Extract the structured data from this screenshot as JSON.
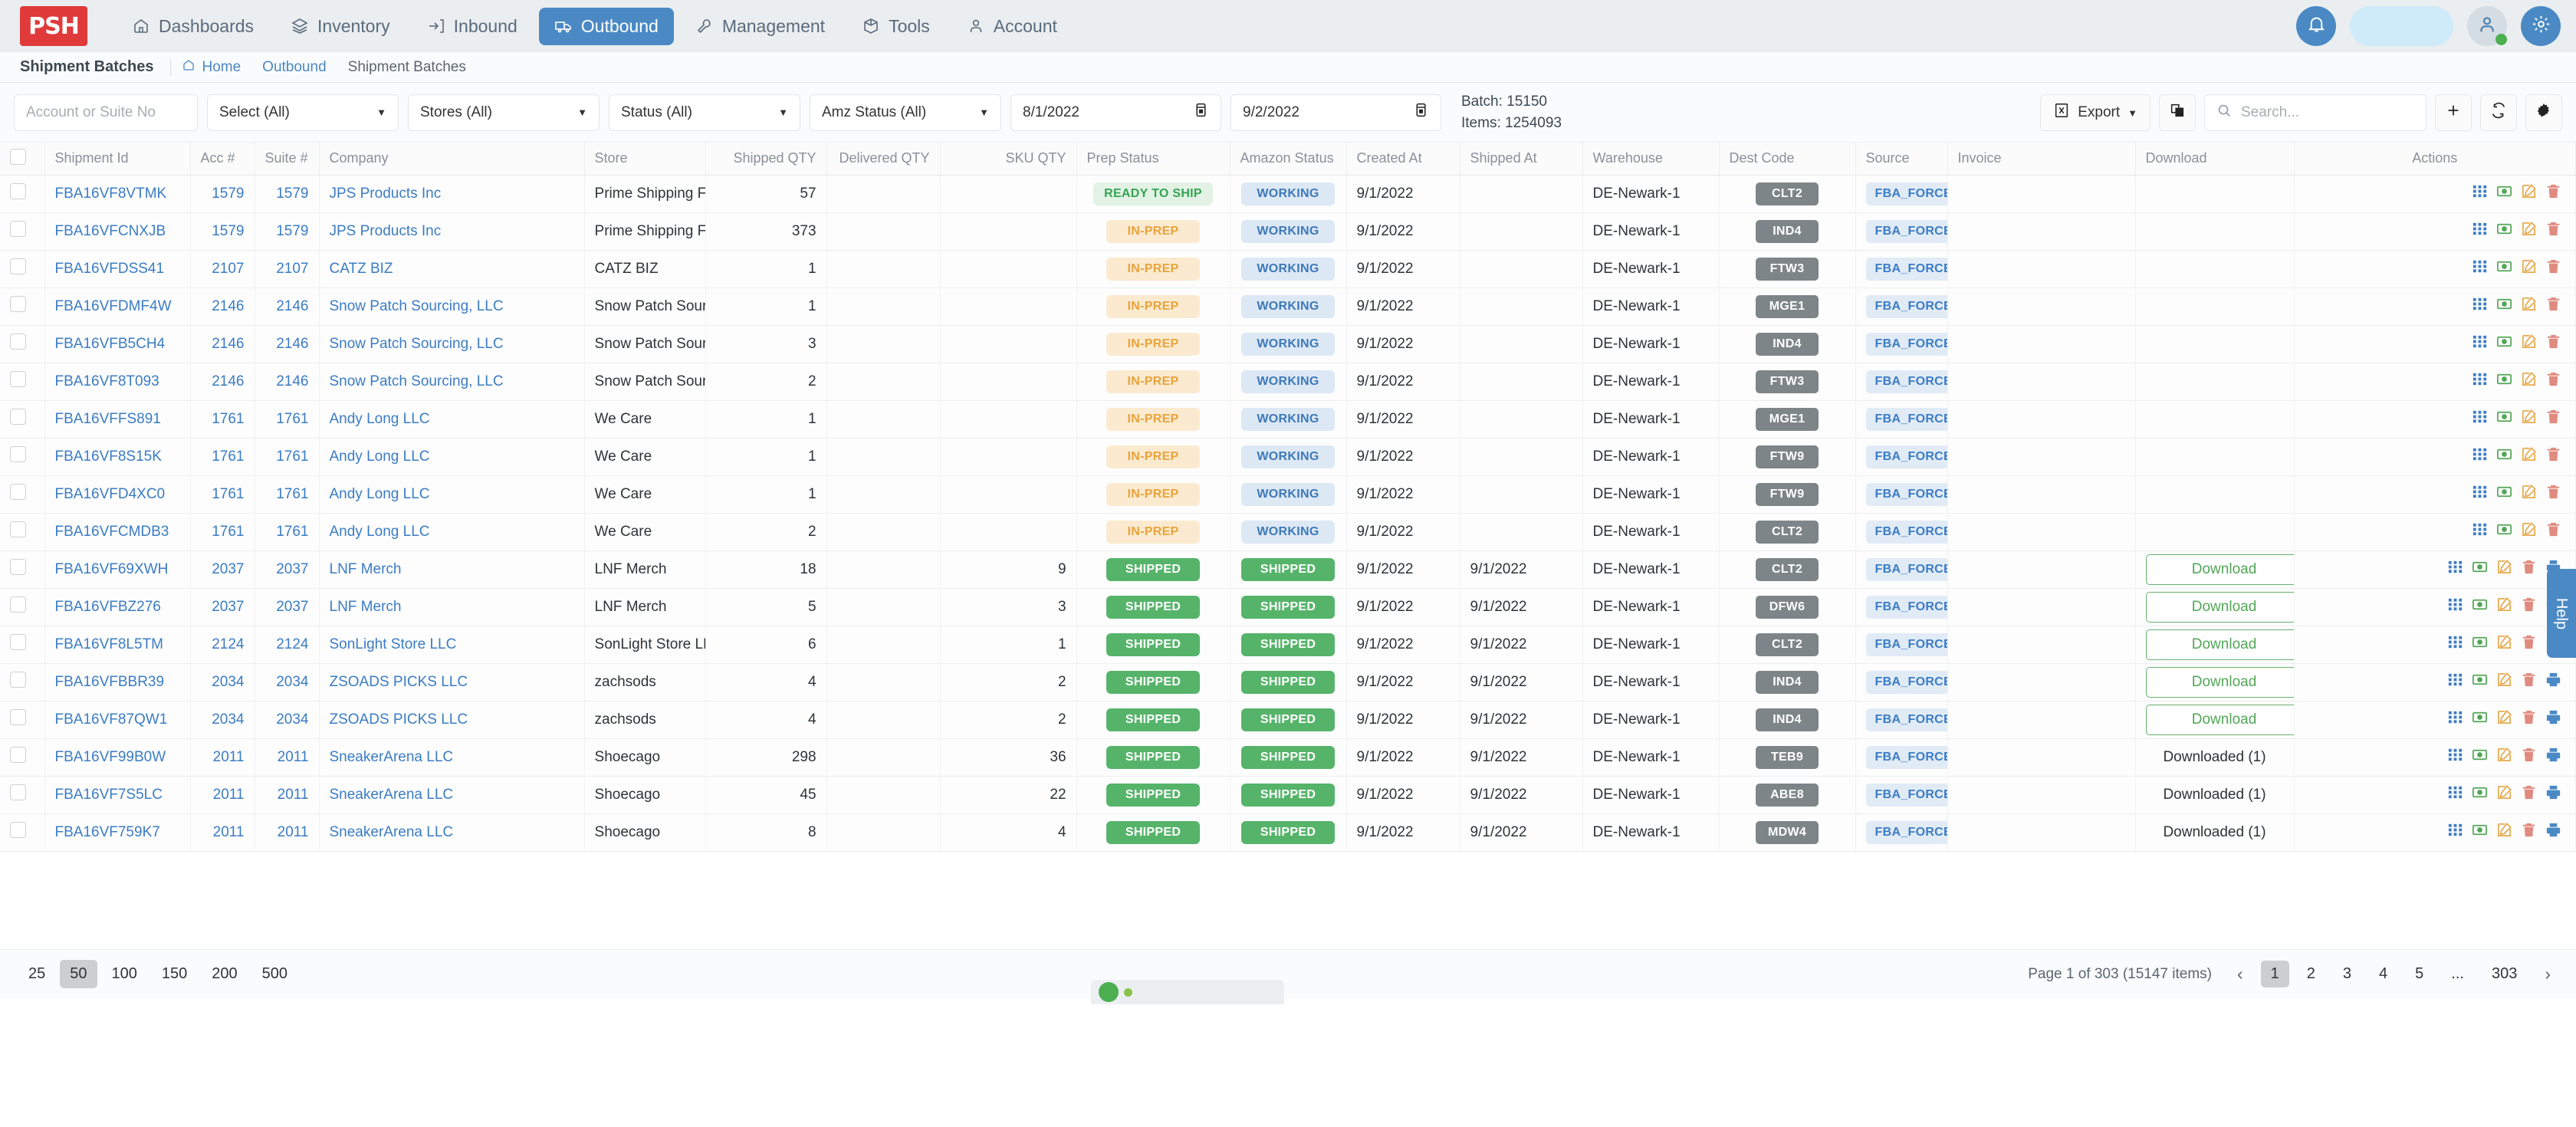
{
  "app": {
    "logo_text": "PSH",
    "brand_color": "#e03a3a",
    "accent_color": "#4a89c4"
  },
  "topnav": {
    "items": [
      {
        "label": "Dashboards",
        "icon": "home-icon",
        "active": false
      },
      {
        "label": "Inventory",
        "icon": "layers-icon",
        "active": false
      },
      {
        "label": "Inbound",
        "icon": "arrow-into-bracket-icon",
        "active": false
      },
      {
        "label": "Outbound",
        "icon": "truck-icon",
        "active": true
      },
      {
        "label": "Management",
        "icon": "wrench-icon",
        "active": false
      },
      {
        "label": "Tools",
        "icon": "box-icon",
        "active": false
      },
      {
        "label": "Account",
        "icon": "person-icon",
        "active": false
      }
    ]
  },
  "breadcrumb": {
    "title": "Shipment Batches",
    "items": [
      {
        "label": "Home",
        "link": true
      },
      {
        "label": "Outbound",
        "link": true
      },
      {
        "label": "Shipment Batches",
        "link": false
      }
    ]
  },
  "filters": {
    "account_placeholder": "Account or Suite No",
    "account_value": "",
    "select_all": "Select (All)",
    "stores_all": "Stores (All)",
    "status_all": "Status (All)",
    "amz_status_all": "Amz Status (All)",
    "date_from": "8/1/2022",
    "date_to": "9/2/2022",
    "batch_label": "Batch: 15150",
    "items_label": "Items: 1254093",
    "export_label": "Export",
    "search_placeholder": "Search...",
    "search_value": ""
  },
  "table": {
    "columns": [
      "Shipment Id",
      "Acc #",
      "Suite #",
      "Company",
      "Store",
      "Shipped QTY",
      "Delivered QTY",
      "SKU QTY",
      "Prep Status",
      "Amazon Status",
      "Created At",
      "Shipped At",
      "Warehouse",
      "Dest Code",
      "Source",
      "Invoice",
      "Download",
      "Actions"
    ],
    "rows": [
      {
        "shipment_id": "FBA16VF8VTMK",
        "acc": "1579",
        "suite": "1579",
        "company": "JPS Products Inc",
        "store": "Prime Shipping Fast",
        "shipped_qty": "57",
        "delivered_qty": "",
        "sku_qty": "",
        "prep_status": "READY TO SHIP",
        "amazon_status": "WORKING",
        "created_at": "9/1/2022",
        "shipped_at": "",
        "warehouse": "DE-Newark-1",
        "dest_code": "CLT2",
        "source": "FBA_FORCE",
        "invoice": "",
        "download": ""
      },
      {
        "shipment_id": "FBA16VFCNXJB",
        "acc": "1579",
        "suite": "1579",
        "company": "JPS Products Inc",
        "store": "Prime Shipping Fast",
        "shipped_qty": "373",
        "delivered_qty": "",
        "sku_qty": "",
        "prep_status": "IN-PREP",
        "amazon_status": "WORKING",
        "created_at": "9/1/2022",
        "shipped_at": "",
        "warehouse": "DE-Newark-1",
        "dest_code": "IND4",
        "source": "FBA_FORCE",
        "invoice": "",
        "download": ""
      },
      {
        "shipment_id": "FBA16VFDSS41",
        "acc": "2107",
        "suite": "2107",
        "company": "CATZ BIZ",
        "store": "CATZ BIZ",
        "shipped_qty": "1",
        "delivered_qty": "",
        "sku_qty": "",
        "prep_status": "IN-PREP",
        "amazon_status": "WORKING",
        "created_at": "9/1/2022",
        "shipped_at": "",
        "warehouse": "DE-Newark-1",
        "dest_code": "FTW3",
        "source": "FBA_FORCE",
        "invoice": "",
        "download": ""
      },
      {
        "shipment_id": "FBA16VFDMF4W",
        "acc": "2146",
        "suite": "2146",
        "company": "Snow Patch Sourcing, LLC",
        "store": "Snow Patch Sourcing, LLC",
        "shipped_qty": "1",
        "delivered_qty": "",
        "sku_qty": "",
        "prep_status": "IN-PREP",
        "amazon_status": "WORKING",
        "created_at": "9/1/2022",
        "shipped_at": "",
        "warehouse": "DE-Newark-1",
        "dest_code": "MGE1",
        "source": "FBA_FORCE",
        "invoice": "",
        "download": ""
      },
      {
        "shipment_id": "FBA16VFB5CH4",
        "acc": "2146",
        "suite": "2146",
        "company": "Snow Patch Sourcing, LLC",
        "store": "Snow Patch Sourcing, LLC",
        "shipped_qty": "3",
        "delivered_qty": "",
        "sku_qty": "",
        "prep_status": "IN-PREP",
        "amazon_status": "WORKING",
        "created_at": "9/1/2022",
        "shipped_at": "",
        "warehouse": "DE-Newark-1",
        "dest_code": "IND4",
        "source": "FBA_FORCE",
        "invoice": "",
        "download": ""
      },
      {
        "shipment_id": "FBA16VF8T093",
        "acc": "2146",
        "suite": "2146",
        "company": "Snow Patch Sourcing, LLC",
        "store": "Snow Patch Sourcing, LLC",
        "shipped_qty": "2",
        "delivered_qty": "",
        "sku_qty": "",
        "prep_status": "IN-PREP",
        "amazon_status": "WORKING",
        "created_at": "9/1/2022",
        "shipped_at": "",
        "warehouse": "DE-Newark-1",
        "dest_code": "FTW3",
        "source": "FBA_FORCE",
        "invoice": "",
        "download": ""
      },
      {
        "shipment_id": "FBA16VFFS891",
        "acc": "1761",
        "suite": "1761",
        "company": "Andy Long LLC",
        "store": "We Care",
        "shipped_qty": "1",
        "delivered_qty": "",
        "sku_qty": "",
        "prep_status": "IN-PREP",
        "amazon_status": "WORKING",
        "created_at": "9/1/2022",
        "shipped_at": "",
        "warehouse": "DE-Newark-1",
        "dest_code": "MGE1",
        "source": "FBA_FORCE",
        "invoice": "",
        "download": ""
      },
      {
        "shipment_id": "FBA16VF8S15K",
        "acc": "1761",
        "suite": "1761",
        "company": "Andy Long LLC",
        "store": "We Care",
        "shipped_qty": "1",
        "delivered_qty": "",
        "sku_qty": "",
        "prep_status": "IN-PREP",
        "amazon_status": "WORKING",
        "created_at": "9/1/2022",
        "shipped_at": "",
        "warehouse": "DE-Newark-1",
        "dest_code": "FTW9",
        "source": "FBA_FORCE",
        "invoice": "",
        "download": ""
      },
      {
        "shipment_id": "FBA16VFD4XC0",
        "acc": "1761",
        "suite": "1761",
        "company": "Andy Long LLC",
        "store": "We Care",
        "shipped_qty": "1",
        "delivered_qty": "",
        "sku_qty": "",
        "prep_status": "IN-PREP",
        "amazon_status": "WORKING",
        "created_at": "9/1/2022",
        "shipped_at": "",
        "warehouse": "DE-Newark-1",
        "dest_code": "FTW9",
        "source": "FBA_FORCE",
        "invoice": "",
        "download": ""
      },
      {
        "shipment_id": "FBA16VFCMDB3",
        "acc": "1761",
        "suite": "1761",
        "company": "Andy Long LLC",
        "store": "We Care",
        "shipped_qty": "2",
        "delivered_qty": "",
        "sku_qty": "",
        "prep_status": "IN-PREP",
        "amazon_status": "WORKING",
        "created_at": "9/1/2022",
        "shipped_at": "",
        "warehouse": "DE-Newark-1",
        "dest_code": "CLT2",
        "source": "FBA_FORCE",
        "invoice": "",
        "download": ""
      },
      {
        "shipment_id": "FBA16VF69XWH",
        "acc": "2037",
        "suite": "2037",
        "company": "LNF Merch",
        "store": "LNF Merch",
        "shipped_qty": "18",
        "delivered_qty": "",
        "sku_qty": "9",
        "prep_status": "SHIPPED",
        "amazon_status": "SHIPPED",
        "created_at": "9/1/2022",
        "shipped_at": "9/1/2022",
        "warehouse": "DE-Newark-1",
        "dest_code": "CLT2",
        "source": "FBA_FORCE",
        "invoice": "",
        "download": "Download"
      },
      {
        "shipment_id": "FBA16VFBZ276",
        "acc": "2037",
        "suite": "2037",
        "company": "LNF Merch",
        "store": "LNF Merch",
        "shipped_qty": "5",
        "delivered_qty": "",
        "sku_qty": "3",
        "prep_status": "SHIPPED",
        "amazon_status": "SHIPPED",
        "created_at": "9/1/2022",
        "shipped_at": "9/1/2022",
        "warehouse": "DE-Newark-1",
        "dest_code": "DFW6",
        "source": "FBA_FORCE",
        "invoice": "",
        "download": "Download"
      },
      {
        "shipment_id": "FBA16VF8L5TM",
        "acc": "2124",
        "suite": "2124",
        "company": "SonLight Store LLC",
        "store": "SonLight Store LLC",
        "shipped_qty": "6",
        "delivered_qty": "",
        "sku_qty": "1",
        "prep_status": "SHIPPED",
        "amazon_status": "SHIPPED",
        "created_at": "9/1/2022",
        "shipped_at": "9/1/2022",
        "warehouse": "DE-Newark-1",
        "dest_code": "CLT2",
        "source": "FBA_FORCE",
        "invoice": "",
        "download": "Download"
      },
      {
        "shipment_id": "FBA16VFBBR39",
        "acc": "2034",
        "suite": "2034",
        "company": "ZSOADS PICKS LLC",
        "store": "zachsods",
        "shipped_qty": "4",
        "delivered_qty": "",
        "sku_qty": "2",
        "prep_status": "SHIPPED",
        "amazon_status": "SHIPPED",
        "created_at": "9/1/2022",
        "shipped_at": "9/1/2022",
        "warehouse": "DE-Newark-1",
        "dest_code": "IND4",
        "source": "FBA_FORCE",
        "invoice": "",
        "download": "Download"
      },
      {
        "shipment_id": "FBA16VF87QW1",
        "acc": "2034",
        "suite": "2034",
        "company": "ZSOADS PICKS LLC",
        "store": "zachsods",
        "shipped_qty": "4",
        "delivered_qty": "",
        "sku_qty": "2",
        "prep_status": "SHIPPED",
        "amazon_status": "SHIPPED",
        "created_at": "9/1/2022",
        "shipped_at": "9/1/2022",
        "warehouse": "DE-Newark-1",
        "dest_code": "IND4",
        "source": "FBA_FORCE",
        "invoice": "",
        "download": "Download"
      },
      {
        "shipment_id": "FBA16VF99B0W",
        "acc": "2011",
        "suite": "2011",
        "company": "SneakerArena LLC",
        "store": "Shoecago",
        "shipped_qty": "298",
        "delivered_qty": "",
        "sku_qty": "36",
        "prep_status": "SHIPPED",
        "amazon_status": "SHIPPED",
        "created_at": "9/1/2022",
        "shipped_at": "9/1/2022",
        "warehouse": "DE-Newark-1",
        "dest_code": "TEB9",
        "source": "FBA_FORCE",
        "invoice": "",
        "download": "Downloaded (1)"
      },
      {
        "shipment_id": "FBA16VF7S5LC",
        "acc": "2011",
        "suite": "2011",
        "company": "SneakerArena LLC",
        "store": "Shoecago",
        "shipped_qty": "45",
        "delivered_qty": "",
        "sku_qty": "22",
        "prep_status": "SHIPPED",
        "amazon_status": "SHIPPED",
        "created_at": "9/1/2022",
        "shipped_at": "9/1/2022",
        "warehouse": "DE-Newark-1",
        "dest_code": "ABE8",
        "source": "FBA_FORCE",
        "invoice": "",
        "download": "Downloaded (1)"
      },
      {
        "shipment_id": "FBA16VF759K7",
        "acc": "2011",
        "suite": "2011",
        "company": "SneakerArena LLC",
        "store": "Shoecago",
        "shipped_qty": "8",
        "delivered_qty": "",
        "sku_qty": "4",
        "prep_status": "SHIPPED",
        "amazon_status": "SHIPPED",
        "created_at": "9/1/2022",
        "shipped_at": "9/1/2022",
        "warehouse": "DE-Newark-1",
        "dest_code": "MDW4",
        "source": "FBA_FORCE",
        "invoice": "",
        "download": "Downloaded (1)"
      }
    ]
  },
  "help_tab": {
    "label": "Help"
  },
  "footer": {
    "page_sizes": [
      "25",
      "50",
      "100",
      "150",
      "200",
      "500"
    ],
    "page_size_selected": "50",
    "page_info": "Page 1 of 303 (15147 items)",
    "pages": [
      "1",
      "2",
      "3",
      "4",
      "5",
      "...",
      "303"
    ],
    "page_selected": "1",
    "prev": "‹",
    "next": "›"
  }
}
